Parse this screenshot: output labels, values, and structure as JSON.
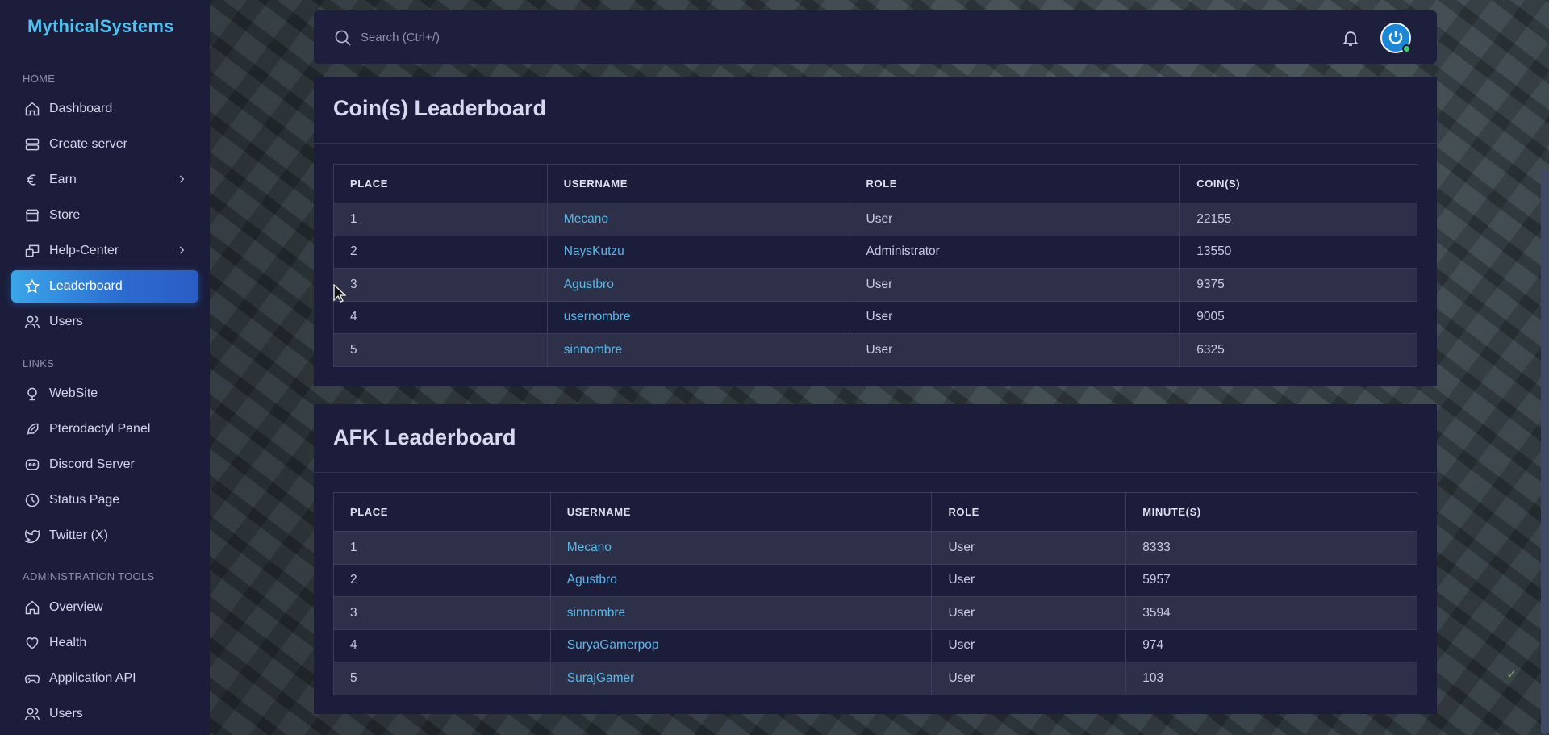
{
  "app": {
    "title": "MythicalSystems"
  },
  "sidebar": {
    "sections": [
      {
        "title": "HOME"
      },
      {
        "title": "LINKS"
      },
      {
        "title": "ADMINISTRATION TOOLS"
      }
    ],
    "home_items": [
      {
        "label": "Dashboard",
        "icon": "home-icon"
      },
      {
        "label": "Create server",
        "icon": "server-icon"
      },
      {
        "label": "Earn",
        "icon": "euro-icon"
      },
      {
        "label": "Store",
        "icon": "store-icon"
      },
      {
        "label": "Help-Center",
        "icon": "help-center-icon"
      },
      {
        "label": "Leaderboard",
        "icon": "star-icon",
        "active": true
      },
      {
        "label": "Users",
        "icon": "users-icon"
      }
    ],
    "link_items": [
      {
        "label": "WebSite",
        "icon": "website-icon"
      },
      {
        "label": "Pterodactyl Panel",
        "icon": "feather-icon"
      },
      {
        "label": "Discord Server",
        "icon": "discord-icon"
      },
      {
        "label": "Status Page",
        "icon": "clock-icon"
      },
      {
        "label": "Twitter (X)",
        "icon": "twitter-icon"
      }
    ],
    "admin_items": [
      {
        "label": "Overview",
        "icon": "home-icon"
      },
      {
        "label": "Health",
        "icon": "heart-icon"
      },
      {
        "label": "Application API",
        "icon": "gamepad-icon"
      },
      {
        "label": "Users",
        "icon": "users-icon"
      }
    ]
  },
  "topbar": {
    "search_placeholder": "Search (Ctrl+/)"
  },
  "coins_board": {
    "title": "Coin(s) Leaderboard",
    "columns": [
      "PLACE",
      "USERNAME",
      "ROLE",
      "COIN(S)"
    ],
    "rows": [
      {
        "place": "1",
        "username": "Mecano",
        "role": "User",
        "value": "22155"
      },
      {
        "place": "2",
        "username": "NaysKutzu",
        "role": "Administrator",
        "value": "13550"
      },
      {
        "place": "3",
        "username": "Agustbro",
        "role": "User",
        "value": "9375"
      },
      {
        "place": "4",
        "username": "usernombre",
        "role": "User",
        "value": "9005"
      },
      {
        "place": "5",
        "username": "sinnombre",
        "role": "User",
        "value": "6325"
      }
    ]
  },
  "afk_board": {
    "title": "AFK Leaderboard",
    "columns": [
      "PLACE",
      "USERNAME",
      "ROLE",
      "MINUTE(S)"
    ],
    "rows": [
      {
        "place": "1",
        "username": "Mecano",
        "role": "User",
        "value": "8333"
      },
      {
        "place": "2",
        "username": "Agustbro",
        "role": "User",
        "value": "5957"
      },
      {
        "place": "3",
        "username": "sinnombre",
        "role": "User",
        "value": "3594"
      },
      {
        "place": "4",
        "username": "SuryaGamerpop",
        "role": "User",
        "value": "974"
      },
      {
        "place": "5",
        "username": "SurajGamer",
        "role": "User",
        "value": "103"
      }
    ]
  },
  "colors": {
    "accent": "#4fc0f0",
    "active_nav": "#2c6bd0",
    "link": "#5bb8ea",
    "sidebar_bg": "#1b1d3a"
  }
}
